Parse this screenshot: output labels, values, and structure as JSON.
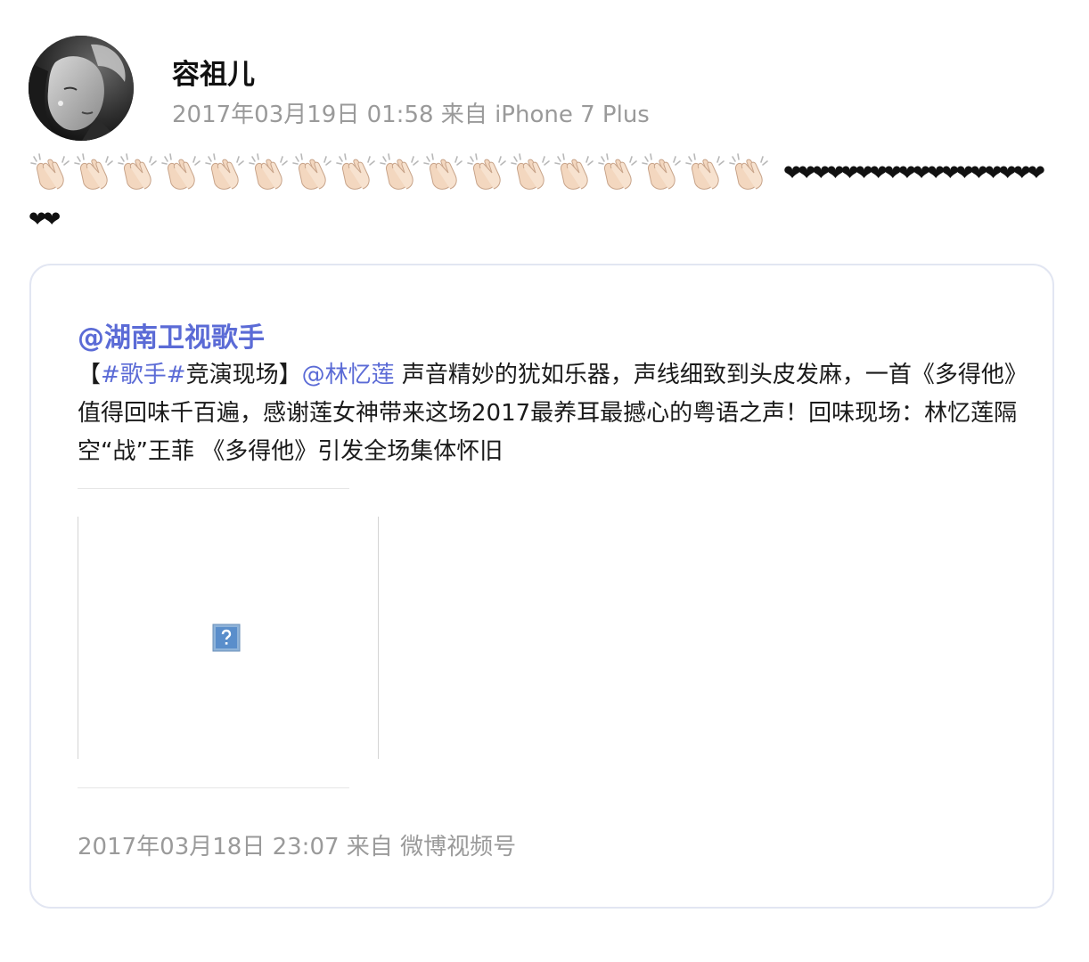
{
  "post": {
    "author": "容祖儿",
    "date": "2017年03月19日 01:58",
    "from_label": "来自",
    "source": "iPhone 7 Plus",
    "clap_count": 17,
    "clap_icon": "clapping-hands-icon",
    "hearts_line1": "❤❤❤❤❤❤❤❤❤❤❤❤❤❤❤❤❤❤",
    "hearts_line2": "❤❤"
  },
  "repost": {
    "author": "@湖南卫视歌手",
    "text_prefix": "【",
    "hashtag": "#歌手#",
    "text_mid": "竞演现场】",
    "mention": "@林忆莲",
    "text_body": " 声音精妙的犹如乐器，声线细致到头皮发麻，一首《多得他》值得回味千百遍，感谢莲女神带来这场2017最养耳最撼心的粤语之声！回味现场：林忆莲隔空“战”王菲 《多得他》引发全场集体怀旧",
    "media_icon": "broken-image-icon",
    "date": "2017年03月18日 23:07",
    "from_label": "来自",
    "source": "微博视频号"
  },
  "colors": {
    "link": "#5b6bd6",
    "meta": "#9a9a9a",
    "card_border": "#e2e6f2"
  }
}
